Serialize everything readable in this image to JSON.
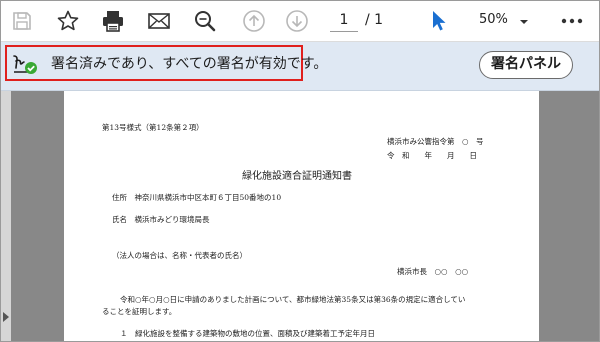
{
  "toolbar": {
    "page_current": "1",
    "page_total": "/  1",
    "zoom": "50%",
    "icons": [
      "save-icon",
      "star-icon",
      "print-icon",
      "mail-icon",
      "zoom-icon",
      "page-up-icon",
      "page-down-icon",
      "cursor-icon",
      "chevron-down-icon",
      "more-icon"
    ]
  },
  "signature_bar": {
    "message": "署名済みであり、すべての署名が有効です。",
    "panel_button": "署名パネル",
    "highlight_color": "#e0201d"
  },
  "document": {
    "form_no": "第13号様式（第12条第２項）",
    "ref_no": "横浜市み公響指令第　○　号",
    "date": "令　和　　年　　月　　日",
    "title": "緑化施設適合証明通知書",
    "address": "住所　神奈川県横浜市中区本町６丁目50番地の10",
    "name": "氏名　横浜市みどり環境局長",
    "note": "（法人の場合は、名称・代表者の氏名）",
    "mayor": "横浜市長　○○　○○",
    "body_line1": "令和○年○月○日に申請のありました計画について、都市緑地法第35条又は第36条の規定に適合してい",
    "body_line2": "ることを証明します。",
    "item1": "１　緑化施設を整備する建築物の敷地の位置、面積及び建築着工予定年月日"
  }
}
